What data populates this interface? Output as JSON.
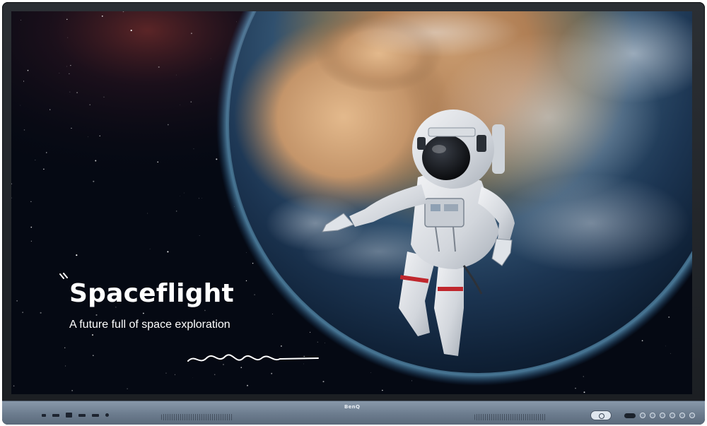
{
  "display": {
    "brand": "BenQ",
    "bezel_color": "#7d8ea1",
    "frame_color": "#23272c"
  },
  "screen": {
    "headline": "Spaceflight",
    "subheadline": "A future full of space exploration",
    "accent_color": "#ffffff",
    "scene": [
      "earth-planet",
      "astronaut",
      "starfield"
    ]
  },
  "front_panel": {
    "ports": [
      "usb-c-port",
      "hdmi-port",
      "usb-a-port",
      "usb-a-port",
      "usb-a-port",
      "audio-port"
    ],
    "buttons": [
      "power-button",
      "input-button",
      "home-button",
      "back-button",
      "volume-down-button",
      "volume-up-button",
      "menu-button"
    ]
  }
}
